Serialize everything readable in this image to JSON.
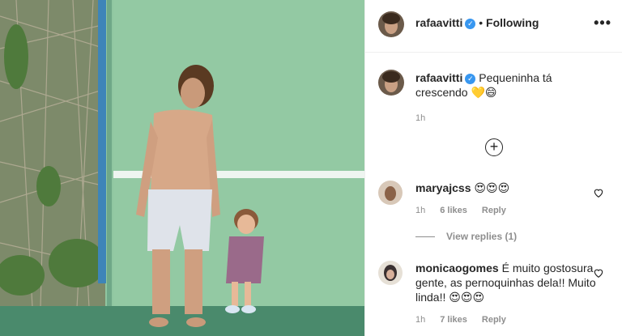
{
  "post": {
    "author": "rafaavitti",
    "follow_status": "Following",
    "more_label": "•••",
    "caption": "Pequeninha tá crescendo 💛😄",
    "time": "1h"
  },
  "comments": [
    {
      "user": "maryajcss",
      "text": "😍😍😍",
      "time": "1h",
      "likes": "6 likes",
      "reply": "Reply"
    },
    {
      "user": "monicaogomes",
      "text": "É muito gostosura gente, as pernoquinhas dela!! Muito linda!! 😍😍😍",
      "time": "1h",
      "likes": "7 likes",
      "reply": "Reply"
    }
  ],
  "view_replies": "View replies (1)",
  "colors": {
    "verified": "#3897f0",
    "wall": "#8fc6a0",
    "court": "#4a8a6c"
  }
}
